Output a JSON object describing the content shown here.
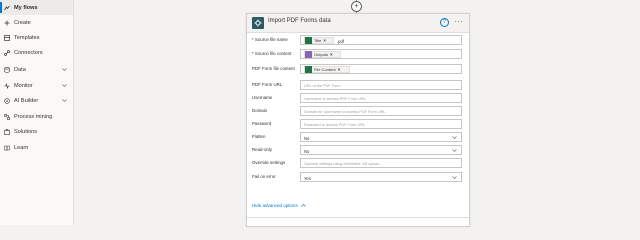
{
  "nav": {
    "items": [
      {
        "label": "My flows",
        "icon": "flow-icon",
        "active": true
      },
      {
        "label": "Create",
        "icon": "plus-icon"
      },
      {
        "label": "Templates",
        "icon": "templates-icon"
      },
      {
        "label": "Connectors",
        "icon": "connectors-icon"
      },
      {
        "label": "Data",
        "icon": "data-icon",
        "expandable": true
      },
      {
        "label": "Monitor",
        "icon": "monitor-icon",
        "expandable": true
      },
      {
        "label": "AI Builder",
        "icon": "ai-builder-icon",
        "expandable": true
      },
      {
        "label": "Process mining",
        "icon": "process-mining-icon"
      },
      {
        "label": "Solutions",
        "icon": "solutions-icon"
      },
      {
        "label": "Learn",
        "icon": "learn-icon"
      }
    ]
  },
  "flow": {
    "add_step_symbol": "+"
  },
  "action": {
    "title": "Import PDF Forms data",
    "help_symbol": "?",
    "more_symbol": "···",
    "fields": {
      "source_file_name": {
        "label": "* Source file name",
        "token": "Title",
        "suffix": ".pdf"
      },
      "source_file_content": {
        "label": "* Source file content",
        "token": "Outputs"
      },
      "pdf_form_file_content": {
        "label": "PDF Form file content",
        "token": "File Content"
      },
      "pdf_form_url": {
        "label": "PDF Form URL",
        "placeholder": "URL of the PDF Form"
      },
      "username": {
        "label": "Username",
        "placeholder": "Username to access PDF Form URL"
      },
      "domain": {
        "label": "Domain",
        "placeholder": "Domain for Username to access PDF Form URL"
      },
      "password": {
        "label": "Password",
        "placeholder": "Password to access PDF Form URL"
      },
      "flatten": {
        "label": "Flatten",
        "value": "No"
      },
      "read_only": {
        "label": "Read-only",
        "value": "No"
      },
      "override_settings": {
        "label": "Override settings",
        "placeholder": "Optional settings using Muhimbi's 'Alt' syntax"
      },
      "fail_on_error": {
        "label": "Fail on error",
        "value": "Yes"
      }
    },
    "hide_advanced": "Hide advanced options"
  },
  "colors": {
    "accent": "#0078d4",
    "connector_icon": "#2e5866",
    "token_excel": "#217346",
    "token_compose": "#8764b8"
  }
}
